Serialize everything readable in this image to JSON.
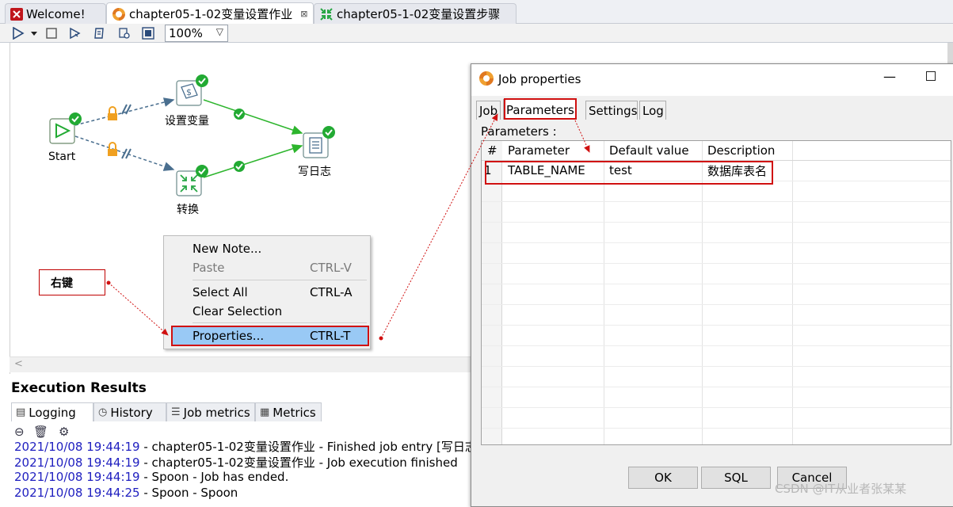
{
  "tabs": [
    {
      "label": "Welcome!",
      "icon": "spoon-logo-icon"
    },
    {
      "label": "chapter05-1-02变量设置作业",
      "icon": "job-icon",
      "close": "⊠"
    },
    {
      "label": "chapter05-1-02变量设置步骤",
      "icon": "transformation-icon"
    }
  ],
  "toolbar": {
    "zoom": "100%"
  },
  "canvas": {
    "nodes": {
      "start": "Start",
      "set_vars": "设置变量",
      "transform": "转换",
      "write_log": "写日志"
    }
  },
  "annotation": {
    "label": "右键"
  },
  "context_menu": {
    "items": [
      {
        "label": "New Note...",
        "shortcut": ""
      },
      {
        "label": "Paste",
        "shortcut": "CTRL-V"
      },
      {
        "label": "Select All",
        "shortcut": "CTRL-A"
      },
      {
        "label": "Clear Selection",
        "shortcut": ""
      },
      {
        "label": "Properties...",
        "shortcut": "CTRL-T"
      }
    ]
  },
  "execution": {
    "title": "Execution Results",
    "tabs": [
      "Logging",
      "History",
      "Job metrics",
      "Metrics"
    ],
    "log": [
      {
        "ts": "2021/10/08 19:44:19",
        "msg": " - chapter05-1-02变量设置作业 - Finished job entry [写日志] ("
      },
      {
        "ts": "2021/10/08 19:44:19",
        "msg": " - chapter05-1-02变量设置作业 - Job execution finished"
      },
      {
        "ts": "2021/10/08 19:44:19",
        "msg": " - Spoon - Job has ended."
      },
      {
        "ts": "2021/10/08 19:44:25",
        "msg": " - Spoon - Spoon"
      }
    ]
  },
  "dialog": {
    "title": "Job properties",
    "tabs": [
      "Job",
      "Parameters",
      "Settings",
      "Log"
    ],
    "params_label": "Parameters :",
    "columns": [
      "#",
      "Parameter",
      "Default value",
      "Description"
    ],
    "rows": [
      {
        "num": "1",
        "parameter": "TABLE_NAME",
        "default": "test",
        "description": "数据库表名"
      }
    ],
    "buttons": {
      "ok": "OK",
      "sql": "SQL",
      "cancel": "Cancel"
    }
  },
  "watermark": "CSDN @IT从业者张某某",
  "colors": {
    "accent_red": "#d01010",
    "ok_green": "#22aa33",
    "selection_blue": "#99c9f5",
    "log_timestamp": "#2020c0"
  }
}
